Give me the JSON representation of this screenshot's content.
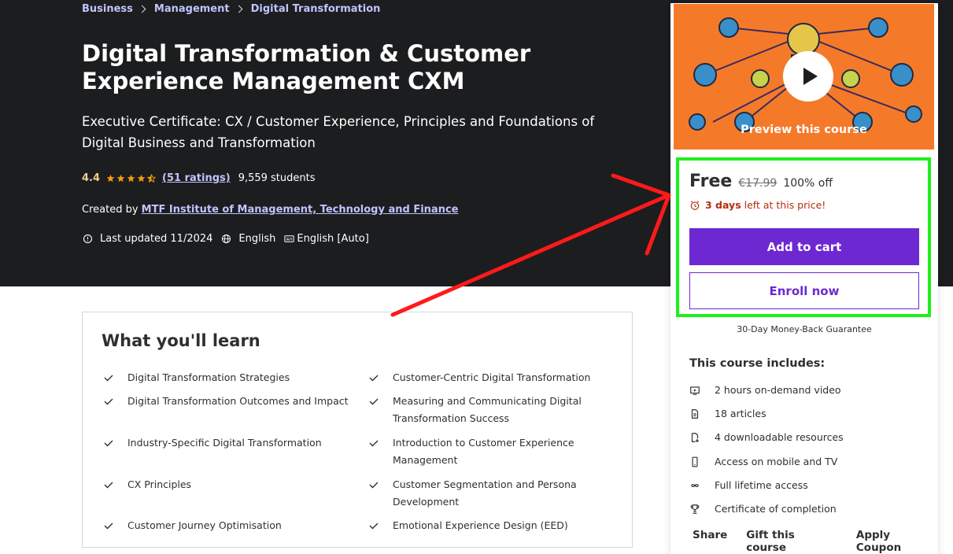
{
  "breadcrumb": [
    "Business",
    "Management",
    "Digital Transformation"
  ],
  "course": {
    "title": "Digital Transformation & Customer Experience Management CXM",
    "subtitle": "Executive Certificate: CX / Customer Experience, Principles and Foundations of Digital Business and Transformation",
    "rating": "4.4",
    "ratings_count": "(51 ratings)",
    "students": "9,559 students",
    "created_by_label": "Created by",
    "author": "MTF Institute of Management, Technology and Finance",
    "last_updated": "Last updated 11/2024",
    "language": "English",
    "captions": "English [Auto]"
  },
  "learn": {
    "title": "What you'll learn",
    "items": [
      "Digital Transformation Strategies",
      "Customer-Centric Digital Transformation",
      "Digital Transformation Outcomes and Impact",
      "Measuring and Communicating Digital Transformation Success",
      "Industry-Specific Digital Transformation",
      "Introduction to Customer Experience Management",
      "CX Principles",
      "Customer Segmentation and Persona Development",
      "Customer Journey Optimisation",
      "Emotional Experience Design (EED)"
    ]
  },
  "sidebar": {
    "preview_label": "Preview this course",
    "price": "Free",
    "original_price": "€17.99",
    "discount": "100% off",
    "timer_days": "3 days",
    "timer_rest": "left at this price!",
    "add_to_cart": "Add to cart",
    "enroll_now": "Enroll now",
    "guarantee": "30-Day Money-Back Guarantee",
    "includes_title": "This course includes:",
    "includes": [
      {
        "icon": "video-icon",
        "text": "2 hours on-demand video"
      },
      {
        "icon": "article-icon",
        "text": "18 articles"
      },
      {
        "icon": "download-icon",
        "text": "4 downloadable resources"
      },
      {
        "icon": "mobile-icon",
        "text": "Access on mobile and TV"
      },
      {
        "icon": "infinity-icon",
        "text": "Full lifetime access"
      },
      {
        "icon": "trophy-icon",
        "text": "Certificate of completion"
      }
    ],
    "links": [
      "Share",
      "Gift this course",
      "Apply Coupon"
    ]
  },
  "colors": {
    "hero_bg": "#1c1d1f",
    "link_purple": "#c0c4fc",
    "star": "#f69c08",
    "brand_purple": "#6d28d2",
    "timer_red": "#b32d0f",
    "highlight_green": "#1df01d",
    "annotation_red": "#ff1a1a"
  }
}
